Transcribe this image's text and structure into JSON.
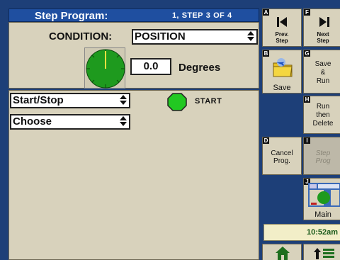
{
  "header": {
    "title": "Step Program:",
    "step_current_index": "1,",
    "step_word": "STEP",
    "step_number": "3",
    "of_word": "OF",
    "step_total": "4"
  },
  "condition": {
    "label": "CONDITION:",
    "value": "POSITION"
  },
  "position": {
    "value": "0.0",
    "unit": "Degrees"
  },
  "controls": {
    "action_select": "Start/Stop",
    "choose_select": "Choose",
    "start_label": "START"
  },
  "buttons": {
    "prev_step": {
      "key": "A",
      "label_line1": "Prev.",
      "label_line2": "Step"
    },
    "next_step": {
      "key": "F",
      "label_line1": "Next",
      "label_line2": "Step"
    },
    "save": {
      "key": "B",
      "label": "Save"
    },
    "save_run": {
      "key": "G",
      "label_line1": "Save",
      "label_line2": "&",
      "label_line3": "Run"
    },
    "run_delete": {
      "key": "H",
      "label_line1": "Run",
      "label_line2": "then",
      "label_line3": "Delete"
    },
    "cancel_prog": {
      "key": "D",
      "label_line1": "Cancel",
      "label_line2": "Prog."
    },
    "step_prog": {
      "key": "I",
      "label_line1": "Step",
      "label_line2": "Prog"
    },
    "main": {
      "key": "J",
      "label": "Main"
    }
  },
  "clock": "10:52am",
  "colors": {
    "background": "#1d3f78",
    "panel": "#d8d2bc",
    "gauge_green": "#1e9a1e",
    "indicator_green": "#22c822"
  },
  "icons": [
    "prev-step-icon",
    "next-step-icon",
    "save-folder-icon",
    "main-screen-thumbnail-icon",
    "home-icon",
    "up-arrow-list-icon"
  ]
}
